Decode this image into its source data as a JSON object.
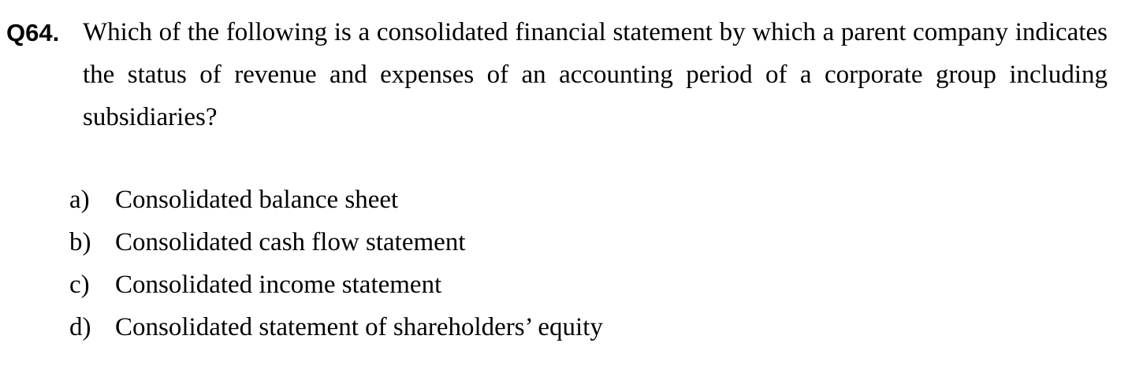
{
  "question": {
    "number": "Q64.",
    "text": "Which of the following is a consolidated financial statement by which a parent company indicates the status of revenue and expenses of an accounting period of a corporate group including subsidiaries?"
  },
  "options": [
    {
      "letter": "a)",
      "text": "Consolidated balance sheet"
    },
    {
      "letter": "b)",
      "text": "Consolidated cash flow statement"
    },
    {
      "letter": "c)",
      "text": "Consolidated income statement"
    },
    {
      "letter": "d)",
      "text": "Consolidated statement of shareholders’ equity"
    }
  ]
}
